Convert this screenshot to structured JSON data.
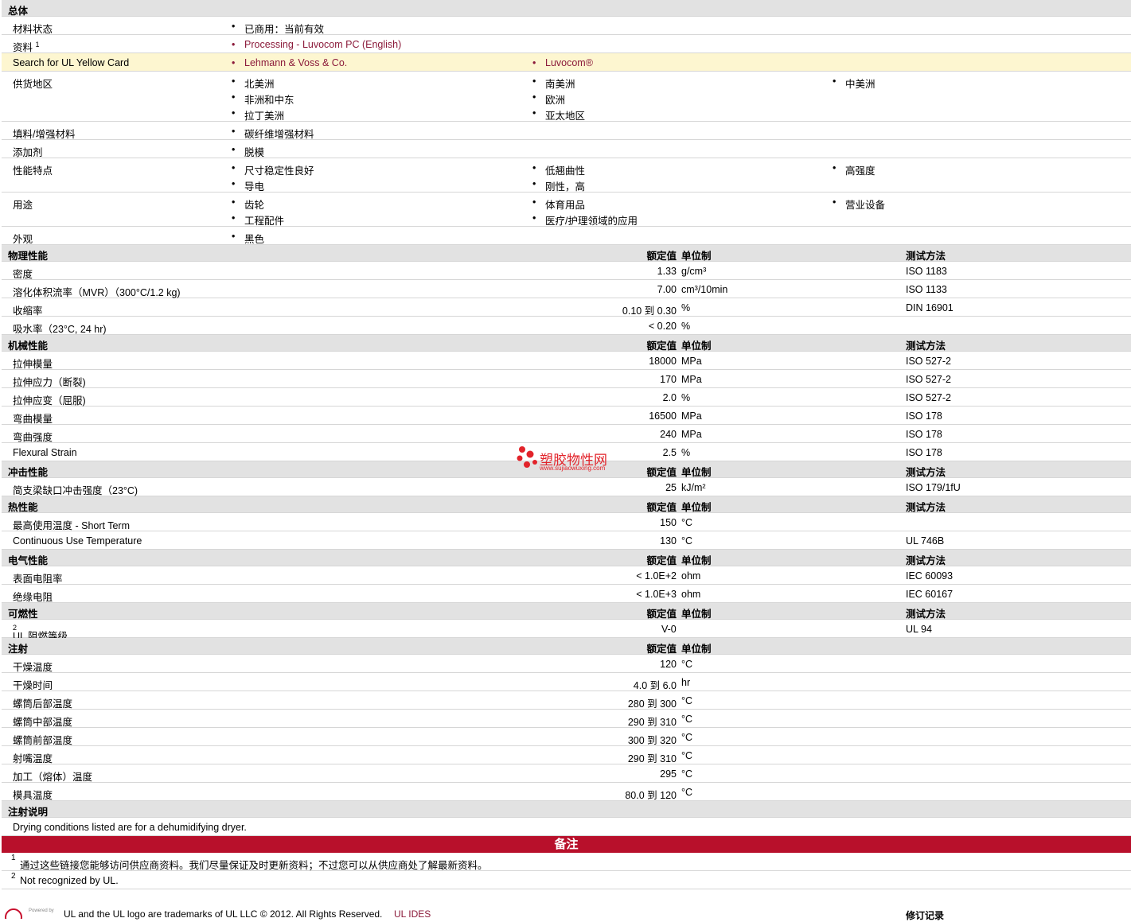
{
  "general": {
    "title": "总体",
    "status_label": "材料状态",
    "status_value": "已商用：当前有效",
    "info_label": "资料",
    "info_sup": "1",
    "info_link": "Processing - Luvocom PC (English)",
    "yellow_label": "Search for UL Yellow Card",
    "yellow_links": [
      "Lehmann & Voss & Co.",
      "Luvocom®"
    ],
    "supply_label": "供货地区",
    "supply_items": [
      "北美洲",
      "非洲和中东",
      "拉丁美洲",
      "南美洲",
      "欧洲",
      "亚太地区",
      "中美洲"
    ],
    "filler_label": "填料/增强材料",
    "filler_value": "碳纤维增强材料",
    "additive_label": "添加剂",
    "additive_value": "脱模",
    "feature_label": "性能特点",
    "feature_items": [
      "尺寸稳定性良好",
      "导电",
      "低翘曲性",
      "刚性，高",
      "高强度"
    ],
    "use_label": "用途",
    "use_items": [
      "齿轮",
      "工程配件",
      "体育用品",
      "医疗/护理领域的应用",
      "营业设备"
    ],
    "appearance_label": "外观",
    "appearance_value": "黑色"
  },
  "col_headers": {
    "value": "额定值",
    "unit": "单位制",
    "test": "测试方法"
  },
  "sections": {
    "physical": {
      "title": "物理性能",
      "rows": [
        {
          "name": "密度",
          "value": "1.33",
          "unit": "g/cm³",
          "test": "ISO 1183"
        },
        {
          "name": "溶化体积流率（MVR）（300°C/1.2 kg)",
          "value": "7.00",
          "unit": "cm³/10min",
          "test": "ISO 1133"
        },
        {
          "name": "收缩率",
          "value": "0.10 到 0.30",
          "unit": "%",
          "test": "DIN 16901"
        },
        {
          "name": "吸水率（23°C, 24 hr)",
          "value": "< 0.20",
          "unit": "%",
          "test": ""
        }
      ]
    },
    "mechanical": {
      "title": "机械性能",
      "rows": [
        {
          "name": "拉伸模量",
          "value": "18000",
          "unit": "MPa",
          "test": "ISO 527-2"
        },
        {
          "name": "拉伸应力（断裂)",
          "value": "170",
          "unit": "MPa",
          "test": "ISO 527-2"
        },
        {
          "name": "拉伸应变（屈服)",
          "value": "2.0",
          "unit": "%",
          "test": "ISO 527-2"
        },
        {
          "name": "弯曲模量",
          "value": "16500",
          "unit": "MPa",
          "test": "ISO 178"
        },
        {
          "name": "弯曲强度",
          "value": "240",
          "unit": "MPa",
          "test": "ISO 178"
        },
        {
          "name": "Flexural Strain",
          "value": "2.5",
          "unit": "%",
          "test": "ISO 178"
        }
      ]
    },
    "impact": {
      "title": "冲击性能",
      "rows": [
        {
          "name": "简支梁缺口冲击强度（23°C)",
          "value": "25",
          "unit": "kJ/m²",
          "test": "ISO 179/1fU"
        }
      ]
    },
    "thermal": {
      "title": "热性能",
      "rows": [
        {
          "name": "最高使用温度 - Short Term",
          "value": "150",
          "unit": "°C",
          "test": ""
        },
        {
          "name": "Continuous Use Temperature",
          "value": "130",
          "unit": "°C",
          "test": "UL 746B"
        }
      ]
    },
    "electrical": {
      "title": "电气性能",
      "rows": [
        {
          "name": "表面电阻率",
          "value": "< 1.0E+2",
          "unit": "ohm",
          "test": "IEC 60093"
        },
        {
          "name": "绝缘电阻",
          "value": "< 1.0E+3",
          "unit": "ohm",
          "test": "IEC 60167"
        }
      ]
    },
    "flammability": {
      "title": "可燃性",
      "row_name": "UL 阻燃等级",
      "row_sup": "2",
      "row_value": "V-0",
      "row_test": "UL 94"
    },
    "injection": {
      "title": "注射",
      "rows": [
        {
          "name": "干燥温度",
          "value": "120",
          "unit": "°C"
        },
        {
          "name": "干燥时间",
          "value": "4.0 到 6.0",
          "unit": "hr"
        },
        {
          "name": "螺筒后部温度",
          "value": "280 到 300",
          "unit": "°C"
        },
        {
          "name": "螺筒中部温度",
          "value": "290 到 310",
          "unit": "°C"
        },
        {
          "name": "螺筒前部温度",
          "value": "300 到 320",
          "unit": "°C"
        },
        {
          "name": "射嘴温度",
          "value": "290 到 310",
          "unit": "°C"
        },
        {
          "name": "加工（熔体）温度",
          "value": "295",
          "unit": "°C"
        },
        {
          "name": "模具温度",
          "value": "80.0 到 120",
          "unit": "°C"
        }
      ]
    },
    "injection_notes": {
      "title": "注射说明",
      "text": "Drying conditions listed are for a dehumidifying dryer."
    }
  },
  "remarks": {
    "title": "备注",
    "notes": [
      {
        "sup": "1",
        "text": "通过这些链接您能够访问供应商资料。我们尽量保证及时更新资料；不过您可以从供应商处了解最新资料。"
      },
      {
        "sup": "2",
        "text": "Not recognized by UL."
      }
    ]
  },
  "watermark": {
    "text": "塑胶物性网",
    "url": "www.sujiaowuxing.com"
  },
  "footer": {
    "powered_by": "Powered by",
    "text": "UL and the UL logo are trademarks of UL LLC © 2012. All Rights Reserved.",
    "link": "UL IDES",
    "revision": "修订记录"
  },
  "colors": {
    "header_bg": "#e2e2e2",
    "link": "#8b1a3a",
    "band": "#b8102b",
    "highlight": "#fdf6d0"
  }
}
